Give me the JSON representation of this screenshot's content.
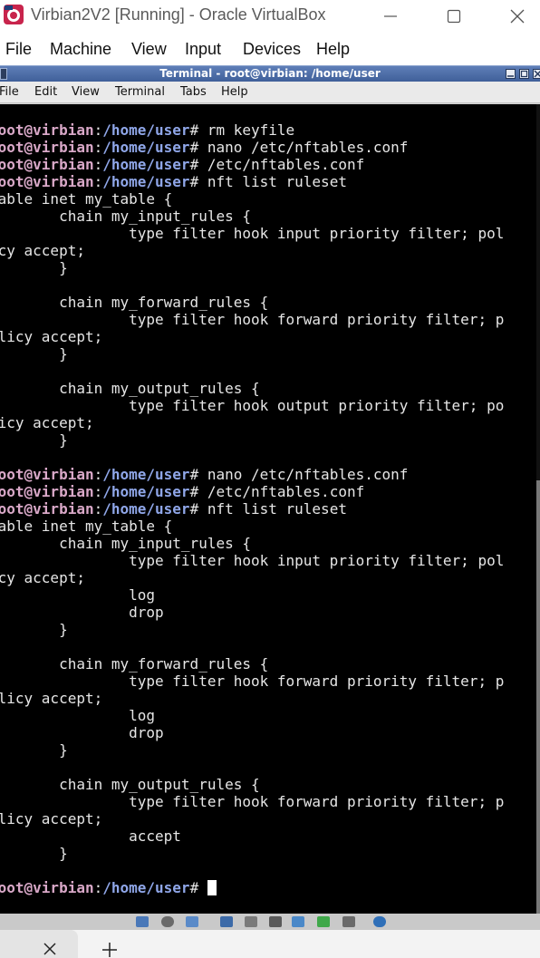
{
  "host_window": {
    "title": "Virbian2V2 [Running] - Oracle VirtualBox",
    "app_icon": "virtualbox-icon",
    "controls": [
      "minimize-icon",
      "maximize-icon",
      "close-icon"
    ]
  },
  "host_menu": {
    "items": [
      "File",
      "Machine",
      "View",
      "Input",
      "Devices",
      "Help"
    ]
  },
  "terminal_window": {
    "title": "Terminal - root@virbian: /home/user",
    "menu": [
      "File",
      "Edit",
      "View",
      "Terminal",
      "Tabs",
      "Help"
    ]
  },
  "terminal": {
    "prompt": {
      "user": "root@virbian",
      "sep": ":",
      "path": "/home/user",
      "symbol": "# "
    },
    "lines": [
      {
        "type": "prompt",
        "cmd": "rm keyfile"
      },
      {
        "type": "prompt",
        "cmd": "nano /etc/nftables.conf"
      },
      {
        "type": "prompt",
        "cmd": "/etc/nftables.conf"
      },
      {
        "type": "prompt",
        "cmd": "nft list ruleset"
      },
      {
        "type": "text",
        "text": "table inet my_table {"
      },
      {
        "type": "text",
        "text": "        chain my_input_rules {"
      },
      {
        "type": "text",
        "text": "                type filter hook input priority filter; pol"
      },
      {
        "type": "text",
        "text": "icy accept;"
      },
      {
        "type": "text",
        "text": "        }"
      },
      {
        "type": "text",
        "text": ""
      },
      {
        "type": "text",
        "text": "        chain my_forward_rules {"
      },
      {
        "type": "text",
        "text": "                type filter hook forward priority filter; p"
      },
      {
        "type": "text",
        "text": "olicy accept;"
      },
      {
        "type": "text",
        "text": "        }"
      },
      {
        "type": "text",
        "text": ""
      },
      {
        "type": "text",
        "text": "        chain my_output_rules {"
      },
      {
        "type": "text",
        "text": "                type filter hook output priority filter; po"
      },
      {
        "type": "text",
        "text": "licy accept;"
      },
      {
        "type": "text",
        "text": "        }"
      },
      {
        "type": "text",
        "text": "}"
      },
      {
        "type": "prompt",
        "cmd": "nano /etc/nftables.conf"
      },
      {
        "type": "prompt",
        "cmd": "/etc/nftables.conf"
      },
      {
        "type": "prompt",
        "cmd": "nft list ruleset"
      },
      {
        "type": "text",
        "text": "table inet my_table {"
      },
      {
        "type": "text",
        "text": "        chain my_input_rules {"
      },
      {
        "type": "text",
        "text": "                type filter hook input priority filter; pol"
      },
      {
        "type": "text",
        "text": "icy accept;"
      },
      {
        "type": "text",
        "text": "                log"
      },
      {
        "type": "text",
        "text": "                drop"
      },
      {
        "type": "text",
        "text": "        }"
      },
      {
        "type": "text",
        "text": ""
      },
      {
        "type": "text",
        "text": "        chain my_forward_rules {"
      },
      {
        "type": "text",
        "text": "                type filter hook forward priority filter; p"
      },
      {
        "type": "text",
        "text": "olicy accept;"
      },
      {
        "type": "text",
        "text": "                log"
      },
      {
        "type": "text",
        "text": "                drop"
      },
      {
        "type": "text",
        "text": "        }"
      },
      {
        "type": "text",
        "text": ""
      },
      {
        "type": "text",
        "text": "        chain my_output_rules {"
      },
      {
        "type": "text",
        "text": "                type filter hook forward priority filter; p"
      },
      {
        "type": "text",
        "text": "olicy accept;"
      },
      {
        "type": "text",
        "text": "                accept"
      },
      {
        "type": "text",
        "text": "        }"
      },
      {
        "type": "text",
        "text": "}"
      },
      {
        "type": "prompt",
        "cmd": "",
        "cursor": true
      }
    ]
  },
  "taskbar": {
    "tab_close_icon": "close-icon",
    "new_tab_icon": "plus-icon"
  },
  "colors": {
    "prompt_user": "#d9a8c8",
    "prompt_path": "#8fa6e8",
    "terminal_bg": "#000000",
    "terminal_titlebar": "#4f6fa8"
  }
}
